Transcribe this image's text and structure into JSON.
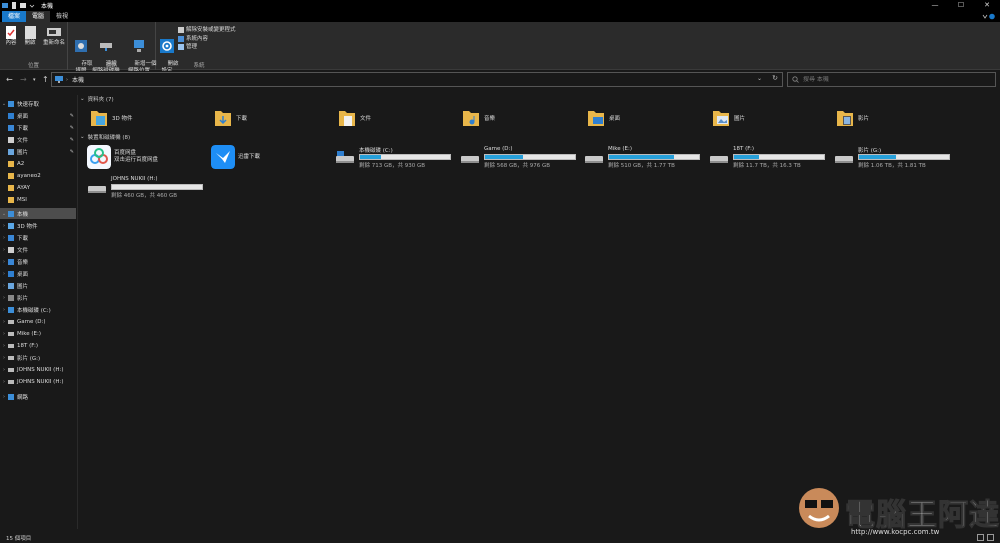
{
  "window": {
    "title": "本機",
    "controls": [
      "—",
      "☐",
      "✕"
    ]
  },
  "tabs": [
    {
      "label": "檔案",
      "kind": "file"
    },
    {
      "label": "電腦",
      "kind": "active"
    },
    {
      "label": "檢視",
      "kind": "normal"
    }
  ],
  "ribbon": {
    "location_group": "位置",
    "network_group": "網路",
    "system_group": "系統",
    "properties": "內容",
    "open": "開啟",
    "rename": "重新命名",
    "access_media": "存取\n媒體",
    "map_drive": "連線\n網路磁碟機",
    "add_location": "新增一個\n網路位置",
    "open_settings": "開啟\n設定",
    "uninstall": "解除安裝或變更程式",
    "system_props": "系統內容",
    "manage": "管理"
  },
  "address": {
    "path": "本機",
    "search_placeholder": "搜尋 本機"
  },
  "nav": {
    "quick_access": "快速存取",
    "qa_items": [
      "桌面",
      "下載",
      "文件",
      "圖片",
      "A2",
      "ayaneo2",
      "AYAY",
      "MSI"
    ],
    "this_pc": "本機",
    "pc_items": [
      "3D 物件",
      "下載",
      "文件",
      "音樂",
      "桌面",
      "圖片",
      "影片",
      "本機磁碟 (C:)",
      "Game (D:)",
      "Mike (E:)",
      "18T (F:)",
      "影片 (G:)",
      "JOHNS NUKII (H:)"
    ],
    "ext_drive": "JOHNS NUKII (H:)",
    "network": "網路"
  },
  "content": {
    "folders_header": "資料夾 (7)",
    "folders": [
      "3D 物件",
      "下載",
      "文件",
      "音樂",
      "桌面",
      "圖片",
      "影片"
    ],
    "devices_header": "裝置和磁碟機 (8)",
    "apps": [
      {
        "line1": "百度网盘",
        "line2": "双击运行百度网盘"
      },
      {
        "line1": "迅雷下載",
        "line2": ""
      }
    ],
    "drives": [
      {
        "name": "本機磁碟 (C:)",
        "free": "剩餘 713 GB，共 930 GB",
        "used_fraction": 0.23
      },
      {
        "name": "Game (D:)",
        "free": "剩餘 568 GB，共 976 GB",
        "used_fraction": 0.42
      },
      {
        "name": "Mike (E:)",
        "free": "剩餘 510 GB，共 1.77 TB",
        "used_fraction": 0.72
      },
      {
        "name": "18T (F:)",
        "free": "剩餘 11.7 TB，共 16.3 TB",
        "used_fraction": 0.28
      },
      {
        "name": "影片 (G:)",
        "free": "剩餘 1.06 TB，共 1.81 TB",
        "used_fraction": 0.41
      },
      {
        "name": "JOHNS NUKII (H:)",
        "free": "剩餘 460 GB，共 460 GB",
        "used_fraction": 0.0
      }
    ]
  },
  "status": {
    "count": "15 個項目"
  },
  "watermark": {
    "text": "電腦王阿達",
    "url": "http://www.kocpc.com.tw"
  },
  "colors": {
    "accent": "#1979ca",
    "bar_fill": "#26a0da",
    "folder": "#e8b64a"
  }
}
